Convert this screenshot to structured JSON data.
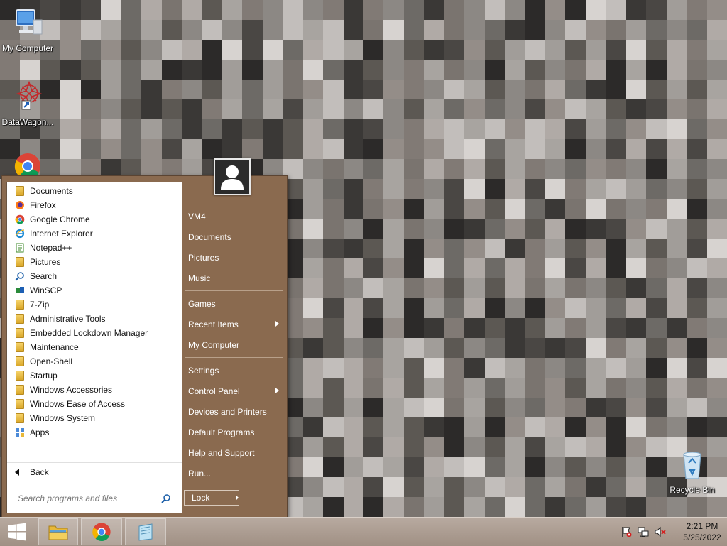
{
  "desktop": {
    "icons": [
      {
        "label": "My Computer",
        "icon": "my-computer-icon"
      },
      {
        "label": "DataWagon...",
        "icon": "datawagon-icon"
      },
      {
        "label": "Recycle Bin",
        "icon": "recycle-bin-icon"
      }
    ]
  },
  "start_menu": {
    "programs": [
      {
        "label": "Documents",
        "icon": "documents-folder-icon"
      },
      {
        "label": "Firefox",
        "icon": "firefox-icon"
      },
      {
        "label": "Google Chrome",
        "icon": "chrome-icon"
      },
      {
        "label": "Internet Explorer",
        "icon": "internet-explorer-icon"
      },
      {
        "label": "Notepad++",
        "icon": "notepadpp-icon"
      },
      {
        "label": "Pictures",
        "icon": "pictures-folder-icon"
      },
      {
        "label": "Search",
        "icon": "search-icon"
      },
      {
        "label": "WinSCP",
        "icon": "winscp-icon"
      },
      {
        "label": "7-Zip",
        "icon": "folder-icon"
      },
      {
        "label": "Administrative Tools",
        "icon": "folder-icon"
      },
      {
        "label": "Embedded Lockdown Manager",
        "icon": "folder-icon"
      },
      {
        "label": "Maintenance",
        "icon": "folder-icon"
      },
      {
        "label": "Open-Shell",
        "icon": "folder-icon"
      },
      {
        "label": "Startup",
        "icon": "folder-icon"
      },
      {
        "label": "Windows Accessories",
        "icon": "folder-icon"
      },
      {
        "label": "Windows Ease of Access",
        "icon": "folder-icon"
      },
      {
        "label": "Windows System",
        "icon": "folder-icon"
      },
      {
        "label": "Apps",
        "icon": "apps-icon"
      }
    ],
    "back_label": "Back",
    "search_placeholder": "Search programs and files",
    "right_items": [
      {
        "label": "VM4",
        "submenu": false
      },
      {
        "label": "Documents",
        "submenu": false
      },
      {
        "label": "Pictures",
        "submenu": false
      },
      {
        "label": "Music",
        "submenu": false
      },
      {
        "label": "Games",
        "submenu": false
      },
      {
        "label": "Recent Items",
        "submenu": true
      },
      {
        "label": "My Computer",
        "submenu": false
      },
      {
        "label": "Settings",
        "submenu": false
      },
      {
        "label": "Control Panel",
        "submenu": true
      },
      {
        "label": "Devices and Printers",
        "submenu": false
      },
      {
        "label": "Default Programs",
        "submenu": false
      },
      {
        "label": "Help and Support",
        "submenu": false
      },
      {
        "label": "Run...",
        "submenu": false
      }
    ],
    "lock_label": "Lock"
  },
  "taskbar": {
    "pinned": [
      "start-icon",
      "file-explorer-icon",
      "chrome-icon",
      "notepad-icon"
    ],
    "clock": {
      "time": "2:21 PM",
      "date": "5/25/2022"
    }
  },
  "colors": {
    "menu_bg": "#8a6a4f",
    "accent": "#1a6fc9"
  }
}
